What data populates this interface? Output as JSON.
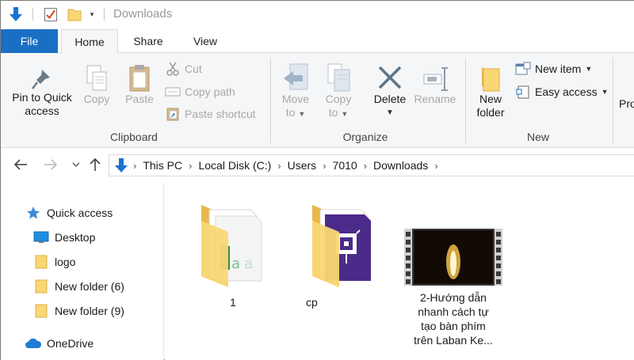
{
  "window": {
    "title": "Downloads"
  },
  "quick_access_toolbar": {
    "icons": [
      "download-arrow-icon",
      "properties-icon",
      "new-folder-icon",
      "customize-dropdown-icon"
    ]
  },
  "tabs": [
    {
      "label": "File"
    },
    {
      "label": "Home"
    },
    {
      "label": "Share"
    },
    {
      "label": "View"
    }
  ],
  "ribbon": {
    "clipboard": {
      "label": "Clipboard",
      "pin": {
        "line1": "Pin to Quick",
        "line2": "access"
      },
      "copy": "Copy",
      "paste": "Paste",
      "cut": "Cut",
      "copy_path": "Copy path",
      "paste_shortcut": "Paste shortcut"
    },
    "organize": {
      "label": "Organize",
      "move_to": {
        "line1": "Move",
        "line2": "to"
      },
      "copy_to": {
        "line1": "Copy",
        "line2": "to"
      },
      "delete": "Delete",
      "rename": "Rename"
    },
    "new": {
      "label": "New",
      "new_folder": {
        "line1": "New",
        "line2": "folder"
      },
      "new_item": "New item",
      "easy_access": "Easy access"
    },
    "open": {
      "partial": "Pro"
    }
  },
  "address": {
    "crumbs": [
      "This PC",
      "Local Disk (C:)",
      "Users",
      "7010",
      "Downloads"
    ]
  },
  "nav_pane": {
    "items": [
      {
        "label": "Quick access",
        "icon": "star-icon"
      },
      {
        "label": "Desktop",
        "icon": "desktop-icon"
      },
      {
        "label": "logo",
        "icon": "folder-icon"
      },
      {
        "label": "New folder (6)",
        "icon": "folder-icon"
      },
      {
        "label": "New folder (9)",
        "icon": "folder-icon"
      },
      {
        "label": "OneDrive",
        "icon": "cloud-icon"
      }
    ]
  },
  "files": [
    {
      "name": "1",
      "type": "folder"
    },
    {
      "name": "cp",
      "type": "folder"
    },
    {
      "name_lines": [
        "2-Hướng dẫn",
        "nhanh cách tự",
        "tạo bàn phím",
        "trên Laban Ke..."
      ],
      "type": "video"
    }
  ],
  "colors": {
    "accent": "#1a6fc4",
    "folder": "#f8d775",
    "folder_dark": "#e8b84a"
  }
}
